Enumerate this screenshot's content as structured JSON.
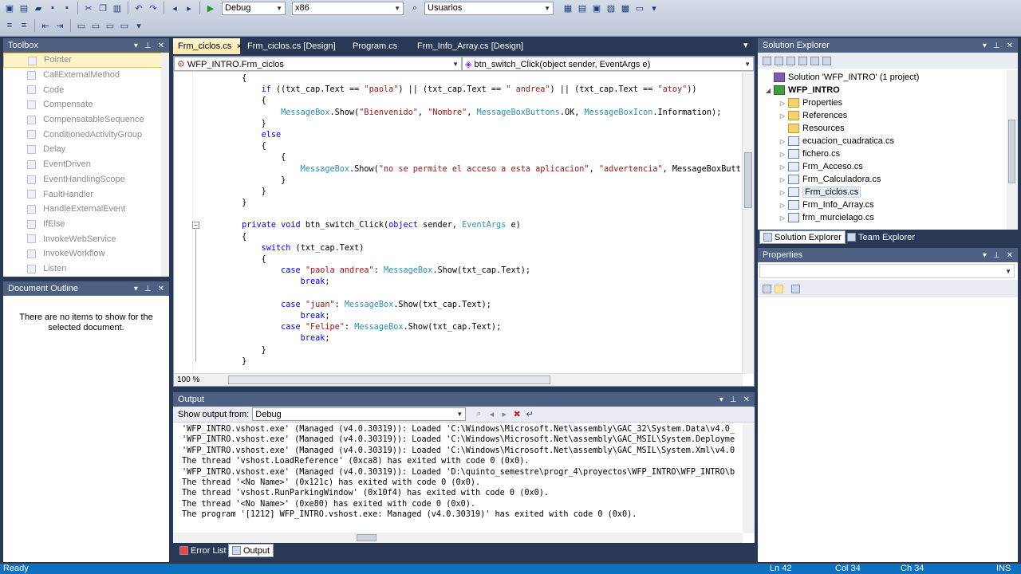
{
  "toolbar": {
    "config_combo": "Debug",
    "platform_combo": "x86",
    "find_combo": "Usuarios"
  },
  "toolbox": {
    "title": "Toolbox",
    "items": [
      "Pointer",
      "CallExternalMethod",
      "Code",
      "Compensate",
      "CompensatableSequence",
      "ConditionedActivityGroup",
      "Delay",
      "EventDriven",
      "EventHandlingScope",
      "FaultHandler",
      "HandleExternalEvent",
      "IfElse",
      "InvokeWebService",
      "InvokeWorkflow",
      "Listen"
    ]
  },
  "document_outline": {
    "title": "Document Outline",
    "message": "There are no items to show for the selected document."
  },
  "editor": {
    "tabs": [
      "Frm_ciclos.cs",
      "Frm_ciclos.cs [Design]",
      "Program.cs",
      "Frm_Info_Array.cs [Design]"
    ],
    "class_combo": "WFP_INTRO.Frm_ciclos",
    "member_combo": "btn_switch_Click(object sender, EventArgs e)",
    "zoom": "100 %",
    "lines": [
      "        {",
      "            if ((txt_cap.Text == \"paola\") || (txt_cap.Text == \" andrea\") || (txt_cap.Text == \"atoy\"))",
      "            {",
      "                MessageBox.Show(\"Bienvenido\", \"Nombre\", MessageBoxButtons.OK, MessageBoxIcon.Information);",
      "            }",
      "            else",
      "            {",
      "                {",
      "                    MessageBox.Show(\"no se permite el acceso a esta aplicacion\", \"advertencia\", MessageBoxButt",
      "                }",
      "            }",
      "        }",
      "",
      "        private void btn_switch_Click(object sender, EventArgs e)",
      "        {",
      "            switch (txt_cap.Text)",
      "            {",
      "                case \"paola andrea\": MessageBox.Show(txt_cap.Text);",
      "                    break;",
      "",
      "                case \"juan\": MessageBox.Show(txt_cap.Text);",
      "                    break;",
      "                case \"Felipe\": MessageBox.Show(txt_cap.Text);",
      "                    break;",
      "            }",
      "        }"
    ]
  },
  "output": {
    "title": "Output",
    "show_from_label": "Show output from:",
    "source_combo": "Debug",
    "lines": [
      "'WFP_INTRO.vshost.exe' (Managed (v4.0.30319)): Loaded 'C:\\Windows\\Microsoft.Net\\assembly\\GAC_32\\System.Data\\v4.0_",
      "'WFP_INTRO.vshost.exe' (Managed (v4.0.30319)): Loaded 'C:\\Windows\\Microsoft.Net\\assembly\\GAC_MSIL\\System.Deployme",
      "'WFP_INTRO.vshost.exe' (Managed (v4.0.30319)): Loaded 'C:\\Windows\\Microsoft.Net\\assembly\\GAC_MSIL\\System.Xml\\v4.0",
      "The thread 'vshost.LoadReference' (0xca8) has exited with code 0 (0x0).",
      "'WFP_INTRO.vshost.exe' (Managed (v4.0.30319)): Loaded 'D:\\quinto_semestre\\progr_4\\proyectos\\WFP_INTRO\\WFP_INTRO\\b",
      "The thread '<No Name>' (0x121c) has exited with code 0 (0x0).",
      "The thread 'vshost.RunParkingWindow' (0x10f4) has exited with code 0 (0x0).",
      "The thread '<No Name>' (0xe80) has exited with code 0 (0x0).",
      "The program '[1212] WFP_INTRO.vshost.exe: Managed (v4.0.30319)' has exited with code 0 (0x0)."
    ],
    "bottom_tabs": [
      "Error List",
      "Output"
    ]
  },
  "solution_explorer": {
    "title": "Solution Explorer",
    "solution": "Solution 'WFP_INTRO' (1 project)",
    "project": "WFP_INTRO",
    "items": [
      "Properties",
      "References",
      "Resources",
      "ecuacion_cuadratica.cs",
      "fichero.cs",
      "Frm_Acceso.cs",
      "Frm_Calculadora.cs",
      "Frm_ciclos.cs",
      "Frm_Info_Array.cs",
      "frm_murcielago.cs"
    ],
    "bottom_tabs": [
      "Solution Explorer",
      "Team Explorer"
    ]
  },
  "properties": {
    "title": "Properties"
  },
  "status": {
    "ready": "Ready",
    "ln": "Ln 42",
    "col": "Col 34",
    "ch": "Ch 34",
    "mode": "INS"
  }
}
